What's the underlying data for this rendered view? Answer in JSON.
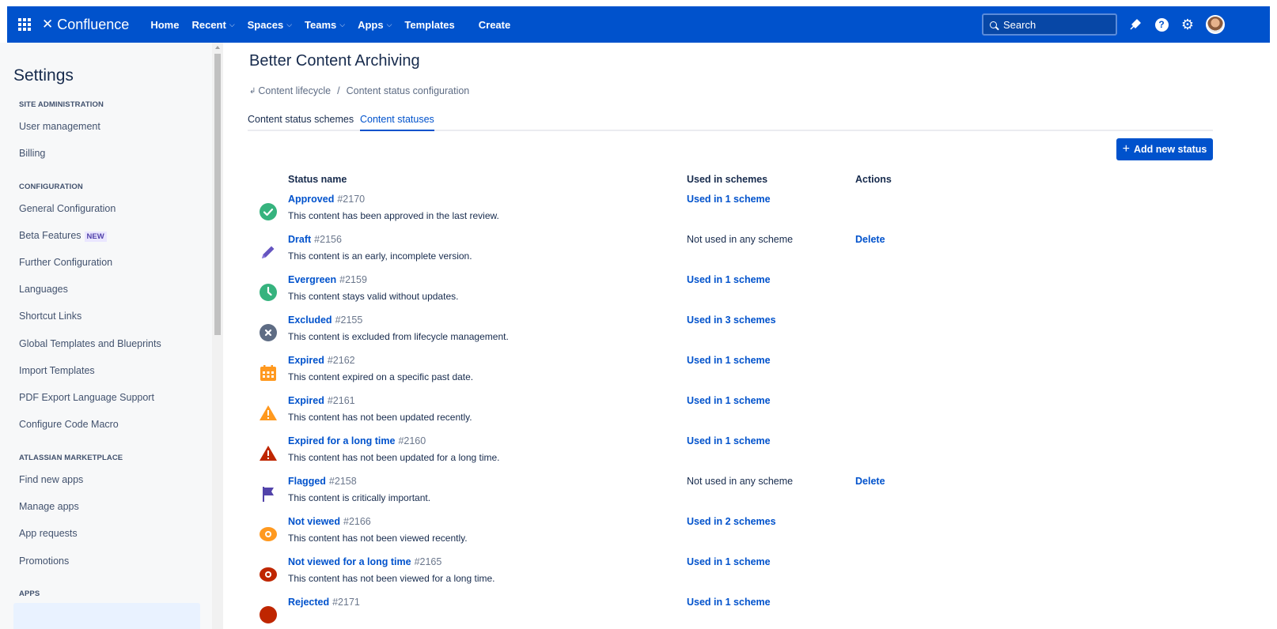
{
  "topnav": {
    "logo_text": "Confluence",
    "items": [
      {
        "label": "Home",
        "dropdown": false
      },
      {
        "label": "Recent",
        "dropdown": true
      },
      {
        "label": "Spaces",
        "dropdown": true
      },
      {
        "label": "Teams",
        "dropdown": true
      },
      {
        "label": "Apps",
        "dropdown": true
      },
      {
        "label": "Templates",
        "dropdown": false
      }
    ],
    "create_label": "Create",
    "search_placeholder": "Search",
    "help_glyph": "?",
    "icons": [
      "app-switcher-icon",
      "confluence-logo-icon",
      "search-icon",
      "notifications-icon",
      "help-icon",
      "settings-gear-icon",
      "avatar"
    ],
    "brand_color": "#0052cc"
  },
  "sidebar": {
    "title": "Settings",
    "sections": [
      {
        "heading": "SITE ADMINISTRATION",
        "items": [
          "User management",
          "Billing"
        ]
      },
      {
        "heading": "CONFIGURATION",
        "items": [
          "General Configuration",
          "Beta Features",
          "Further Configuration",
          "Languages",
          "Shortcut Links",
          "Global Templates and Blueprints",
          "Import Templates",
          "PDF Export Language Support",
          "Configure Code Macro"
        ]
      },
      {
        "heading": "ATLASSIAN MARKETPLACE",
        "items": [
          "Find new apps",
          "Manage apps",
          "App requests",
          "Promotions"
        ]
      },
      {
        "heading": "APPS",
        "items": []
      }
    ],
    "beta_badge": "NEW"
  },
  "main": {
    "title": "Better Content Archiving",
    "breadcrumb": [
      "Content lifecycle",
      "Content status configuration"
    ],
    "breadcrumb_sep": "/",
    "tabs": [
      {
        "label": "Content status schemes",
        "active": false
      },
      {
        "label": "Content statuses",
        "active": true
      }
    ],
    "add_button": "Add new status",
    "add_button_plus": "+",
    "columns": {
      "name": "Status name",
      "used": "Used in schemes",
      "actions": "Actions"
    },
    "statuses": [
      {
        "name": "Approved",
        "id": "#2170",
        "desc": "This content has been approved in the last review.",
        "usage": "Used in 1 scheme",
        "usage_link": true,
        "action": "",
        "icon": "approved-check-icon"
      },
      {
        "name": "Draft",
        "id": "#2156",
        "desc": "This content is an early, incomplete version.",
        "usage": "Not used in any scheme",
        "usage_link": false,
        "action": "Delete",
        "icon": "draft-pencil-icon"
      },
      {
        "name": "Evergreen",
        "id": "#2159",
        "desc": "This content stays valid without updates.",
        "usage": "Used in 1 scheme",
        "usage_link": true,
        "action": "",
        "icon": "evergreen-clock-icon"
      },
      {
        "name": "Excluded",
        "id": "#2155",
        "desc": "This content is excluded from lifecycle management.",
        "usage": "Used in 3 schemes",
        "usage_link": true,
        "action": "",
        "icon": "excluded-x-icon"
      },
      {
        "name": "Expired",
        "id": "#2162",
        "desc": "This content expired on a specific past date.",
        "usage": "Used in 1 scheme",
        "usage_link": true,
        "action": "",
        "icon": "expired-calendar-icon"
      },
      {
        "name": "Expired",
        "id": "#2161",
        "desc": "This content has not been updated recently.",
        "usage": "Used in 1 scheme",
        "usage_link": true,
        "action": "",
        "icon": "expired-warning-icon"
      },
      {
        "name": "Expired for a long time",
        "id": "#2160",
        "desc": "This content has not been updated for a long time.",
        "usage": "Used in 1 scheme",
        "usage_link": true,
        "action": "",
        "icon": "expired-long-warning-icon"
      },
      {
        "name": "Flagged",
        "id": "#2158",
        "desc": "This content is critically important.",
        "usage": "Not used in any scheme",
        "usage_link": false,
        "action": "Delete",
        "icon": "flag-icon"
      },
      {
        "name": "Not viewed",
        "id": "#2166",
        "desc": "This content has not been viewed recently.",
        "usage": "Used in 2 schemes",
        "usage_link": true,
        "action": "",
        "icon": "not-viewed-eye-icon"
      },
      {
        "name": "Not viewed for a long time",
        "id": "#2165",
        "desc": "This content has not been viewed for a long time.",
        "usage": "Used in 1 scheme",
        "usage_link": true,
        "action": "",
        "icon": "not-viewed-long-eye-icon"
      },
      {
        "name": "Rejected",
        "id": "#2171",
        "desc": "",
        "usage": "Used in 1 scheme",
        "usage_link": true,
        "action": "",
        "icon": "rejected-icon"
      }
    ]
  }
}
